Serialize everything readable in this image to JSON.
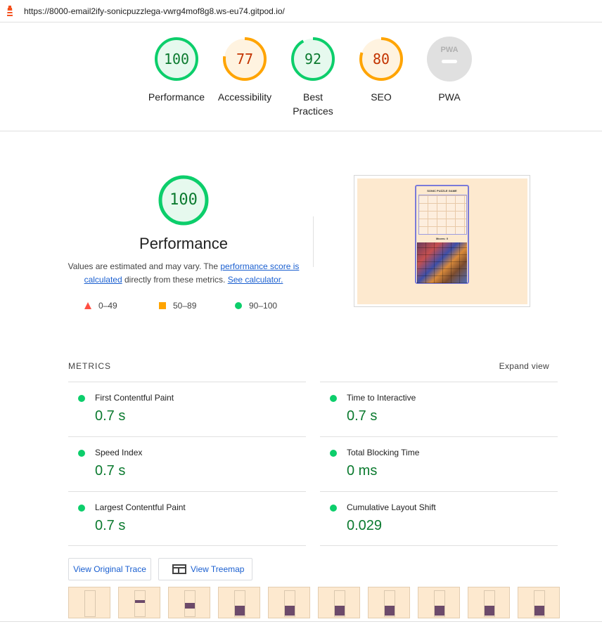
{
  "browser": {
    "url": "https://8000-email2ify-sonicpuzzlega-vwrg4mof8g8.ws-eu74.gitpod.io/"
  },
  "gauges": [
    {
      "label": "Performance",
      "score": "100",
      "value": 1.0,
      "color": "#0cce6b",
      "fill": "#e6f9ee",
      "text_color": "#0b7a2f"
    },
    {
      "label": "Accessibility",
      "score": "77",
      "value": 0.77,
      "color": "#ffa400",
      "fill": "#fff3e0",
      "text_color": "#c33300"
    },
    {
      "label_line1": "Best",
      "label_line2": "Practices",
      "score": "92",
      "value": 0.92,
      "color": "#0cce6b",
      "fill": "#e6f9ee",
      "text_color": "#0b7a2f"
    },
    {
      "label": "SEO",
      "score": "80",
      "value": 0.8,
      "color": "#ffa400",
      "fill": "#fff3e0",
      "text_color": "#c33300"
    },
    {
      "label": "PWA",
      "badge": "PWA",
      "color": "#e0e0e0"
    }
  ],
  "performance": {
    "score": "100",
    "title": "Performance",
    "desc_prefix": "Values are estimated and may vary. The ",
    "desc_link1": "performance score is calculated",
    "desc_mid": " directly from these metrics. ",
    "desc_link2": "See calculator.",
    "legend": [
      {
        "icon": "triangle",
        "range": "0–49",
        "color": "#ff4e42"
      },
      {
        "icon": "square",
        "range": "50–89",
        "color": "#ffa400"
      },
      {
        "icon": "circle",
        "range": "90–100",
        "color": "#0cce6b"
      }
    ]
  },
  "screenshot": {
    "title": "SONIC PUZZLE GAME",
    "moves": "Moves: 0"
  },
  "metrics": {
    "header": "METRICS",
    "expand": "Expand view",
    "items": [
      {
        "name": "First Contentful Paint",
        "value": "0.7 s"
      },
      {
        "name": "Time to Interactive",
        "value": "0.7 s"
      },
      {
        "name": "Speed Index",
        "value": "0.7 s"
      },
      {
        "name": "Total Blocking Time",
        "value": "0 ms"
      },
      {
        "name": "Largest Contentful Paint",
        "value": "0.7 s"
      },
      {
        "name": "Cumulative Layout Shift",
        "value": "0.029"
      }
    ]
  },
  "buttons": {
    "view_trace": "View Original Trace",
    "view_treemap": "View Treemap"
  },
  "filmstrip": {
    "count": 10
  }
}
